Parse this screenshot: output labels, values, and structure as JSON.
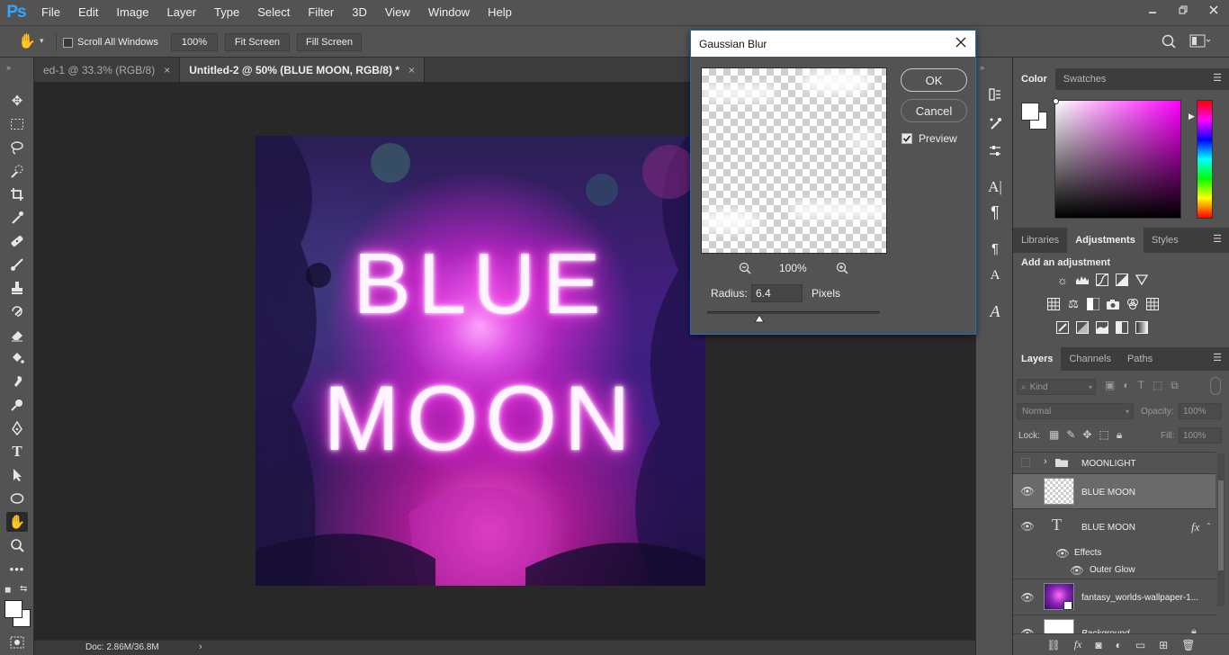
{
  "app": {
    "logo": "Ps"
  },
  "menu": [
    "File",
    "Edit",
    "Image",
    "Layer",
    "Type",
    "Select",
    "Filter",
    "3D",
    "View",
    "Window",
    "Help"
  ],
  "options": {
    "scroll_all_windows": "Scroll All Windows",
    "zoom_100": "100%",
    "fit_screen": "Fit Screen",
    "fill_screen": "Fill Screen"
  },
  "tabs": [
    {
      "label": "ed-1 @ 33.3% (RGB/8)",
      "close": "×"
    },
    {
      "label": "Untitled-2 @ 50% (BLUE MOON, RGB/8) *",
      "close": "×"
    }
  ],
  "artwork": {
    "line1": "BLUE",
    "line2": "MOON"
  },
  "status": {
    "doc": "Doc: 2.86M/36.8M"
  },
  "dialog": {
    "title": "Gaussian Blur",
    "ok": "OK",
    "cancel": "Cancel",
    "preview_label": "Preview",
    "preview_checked": true,
    "zoom": "100%",
    "radius_label": "Radius:",
    "radius_value": "6.4",
    "radius_unit": "Pixels",
    "radius_slider_fraction": 0.3
  },
  "panels": {
    "color_tabs": [
      "Color",
      "Swatches"
    ],
    "adj_tabs": [
      "Libraries",
      "Adjustments",
      "Styles"
    ],
    "adj_heading": "Add an adjustment",
    "layers_tabs": [
      "Layers",
      "Channels",
      "Paths"
    ],
    "filter_kind": "Kind",
    "blend_mode": "Normal",
    "opacity_label": "Opacity:",
    "opacity_value": "100%",
    "lock_label": "Lock:",
    "fill_label": "Fill:",
    "fill_value": "100%",
    "layers": [
      {
        "name": "MOONLIGHT",
        "type": "group"
      },
      {
        "name": "BLUE MOON",
        "type": "pixel",
        "selected": true
      },
      {
        "name": "BLUE MOON",
        "type": "text",
        "fx": "fx"
      },
      {
        "name": "Effects",
        "type": "effects"
      },
      {
        "name": "Outer Glow",
        "type": "effect"
      },
      {
        "name": "fantasy_worlds-wallpaper-1...",
        "type": "image"
      },
      {
        "name": "Background",
        "type": "background"
      }
    ]
  },
  "colors": {
    "ui_bg": "#535353",
    "canvas_bg": "#282828",
    "accent": "#31a8ff",
    "neon": "#ff3fe8"
  }
}
